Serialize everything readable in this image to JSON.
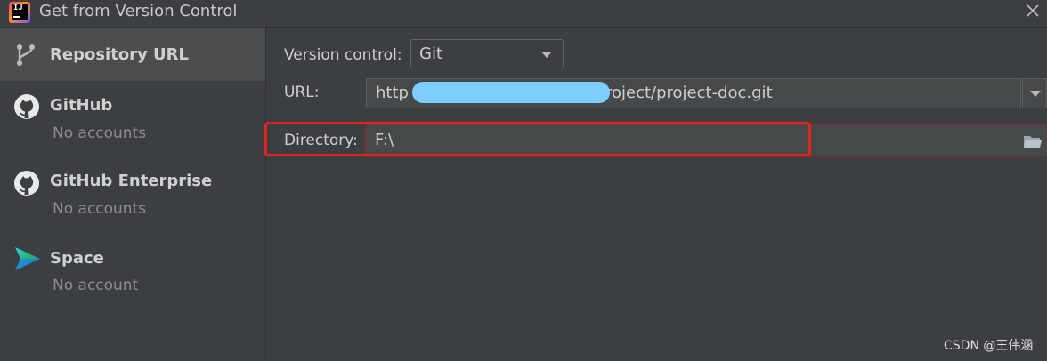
{
  "window": {
    "title": "Get from Version Control",
    "colors": {
      "background": "#3c3f41",
      "selected": "#4b4d4f",
      "field": "#45494a",
      "highlight": "#e5221b"
    }
  },
  "sidebar": {
    "items": [
      {
        "label": "Repository URL",
        "sub": "",
        "icon": "vcs-branch-icon"
      },
      {
        "label": "GitHub",
        "sub": "No accounts",
        "icon": "github-icon"
      },
      {
        "label": "GitHub Enterprise",
        "sub": "No accounts",
        "icon": "github-icon"
      },
      {
        "label": "Space",
        "sub": "No account",
        "icon": "space-icon"
      }
    ]
  },
  "form": {
    "version_control_label": "Version control:",
    "version_control_value": "Git",
    "url_label": "URL:",
    "url_value_start": "http",
    "url_value_end": "roject/project-doc.git",
    "directory_label": "Directory:",
    "directory_value": "F:\\"
  },
  "watermark": "CSDN @王伟涵"
}
